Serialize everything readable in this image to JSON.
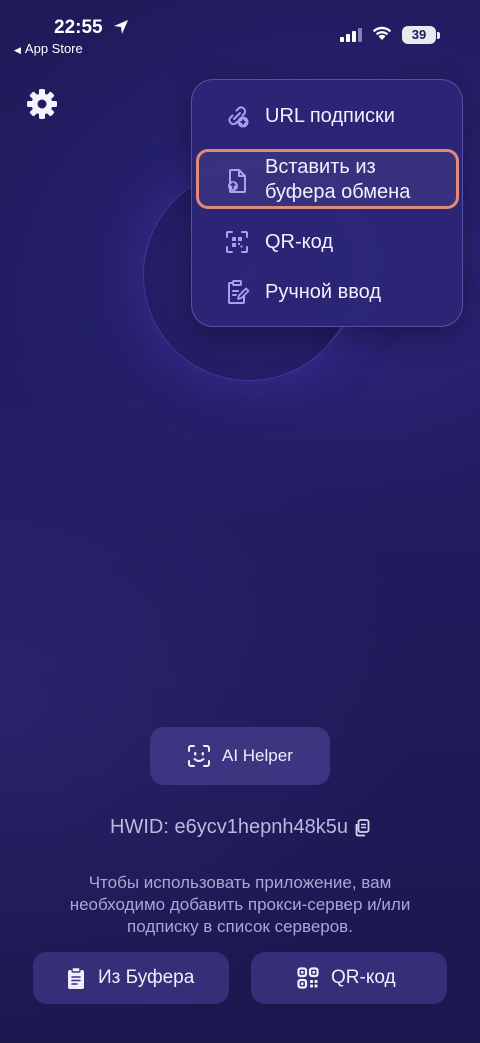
{
  "status_bar": {
    "time": "22:55",
    "back_app": "App Store",
    "battery": "39",
    "icons": [
      "location-arrow-icon",
      "signal-icon",
      "wifi-icon",
      "battery-icon"
    ]
  },
  "header": {
    "settings_icon": "gear-icon"
  },
  "add_menu": {
    "items": [
      {
        "label": "URL подписки",
        "icon": "link-plus-icon"
      },
      {
        "label": "Вставить из\nбуфера обмена",
        "icon": "file-upload-icon",
        "highlighted": true
      },
      {
        "label": "QR-код",
        "icon": "qr-scan-icon"
      },
      {
        "label": "Ручной ввод",
        "icon": "clipboard-edit-icon"
      }
    ],
    "highlight_color": "#e08a7a"
  },
  "ai_helper": {
    "label": "AI Helper",
    "icon": "face-scan-icon"
  },
  "hwid": {
    "text": "HWID: e6ycv1hepnh48k5u",
    "icon": "copy-icon"
  },
  "info_text": "Чтобы использовать приложение, вам необходимо добавить прокси-сервер и/или подписку в список серверов.",
  "bottom_buttons": {
    "clipboard_label": "Из Буфера",
    "clipboard_icon": "clipboard-icon",
    "qr_label": "QR-код",
    "qr_icon": "qr-icon"
  },
  "colors": {
    "background": "#211c60",
    "accent": "#8f85f0",
    "menu_bg": "#2c2676"
  }
}
